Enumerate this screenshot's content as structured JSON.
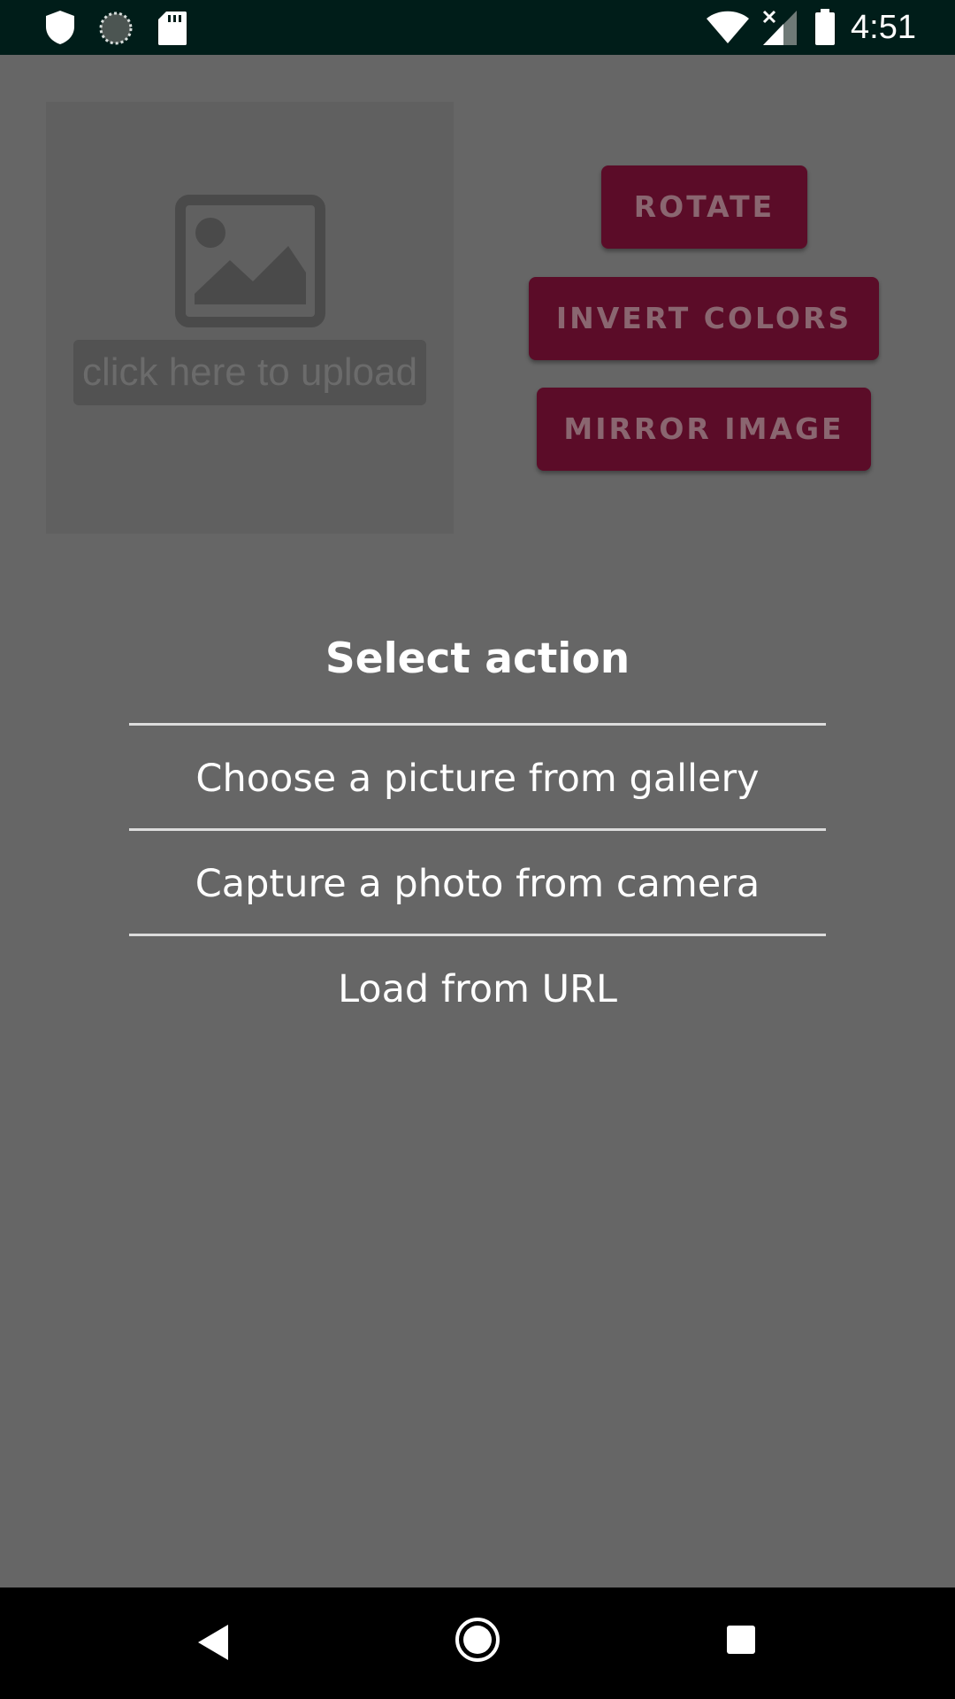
{
  "status_bar": {
    "time": "4:51",
    "left_icons": [
      "shield-icon",
      "sync-icon",
      "sd-card-icon"
    ],
    "right_icons": [
      "wifi-icon",
      "signal-off-icon",
      "battery-icon"
    ]
  },
  "upload": {
    "label": "click here to upload",
    "icon": "image-placeholder-icon"
  },
  "buttons": {
    "rotate": "ROTATE",
    "invert": "INVERT COLORS",
    "mirror": "MIRROR IMAGE"
  },
  "dialog": {
    "title": "Select action",
    "options": [
      "Choose a picture from gallery",
      "Capture a photo from camera",
      "Load from URL"
    ]
  },
  "nav_bar": {
    "icons": [
      "back-icon",
      "home-icon",
      "recents-icon"
    ]
  },
  "colors": {
    "button_bg": "#5b0c28",
    "scrim": "#666666",
    "status_bar": "#001d19"
  }
}
